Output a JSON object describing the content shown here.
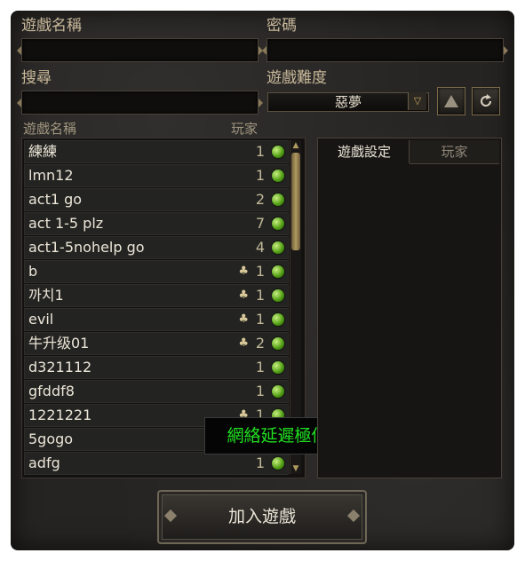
{
  "form": {
    "game_name_label": "遊戲名稱",
    "game_name_value": "",
    "password_label": "密碼",
    "password_value": "",
    "search_label": "搜尋",
    "search_value": "",
    "difficulty_label": "遊戲難度",
    "difficulty_value": "惡夢",
    "difficulty_arrow": "▽"
  },
  "icons": {
    "filter": "delta-icon",
    "refresh": "refresh-icon"
  },
  "list": {
    "header_name": "遊戲名稱",
    "header_players": "玩家",
    "rows": [
      {
        "name": "練練",
        "count": "1",
        "mark": "",
        "status": "ok"
      },
      {
        "name": "lmn12",
        "count": "1",
        "mark": "",
        "status": "ok"
      },
      {
        "name": "act1 go",
        "count": "2",
        "mark": "",
        "status": "ok"
      },
      {
        "name": "act 1-5 plz",
        "count": "7",
        "mark": "",
        "status": "ok"
      },
      {
        "name": "act1-5nohelp go",
        "count": "4",
        "mark": "",
        "status": "ok"
      },
      {
        "name": "b",
        "count": "1",
        "mark": "♣",
        "status": "ok"
      },
      {
        "name": "까치1",
        "count": "1",
        "mark": "♣",
        "status": "ok"
      },
      {
        "name": "evil",
        "count": "1",
        "mark": "♣",
        "status": "ok"
      },
      {
        "name": "牛升级01",
        "count": "2",
        "mark": "♣",
        "status": "ok"
      },
      {
        "name": "d321112",
        "count": "1",
        "mark": "",
        "status": "ok"
      },
      {
        "name": "gfddf8",
        "count": "1",
        "mark": "",
        "status": "ok"
      },
      {
        "name": "1221221",
        "count": "1",
        "mark": "♣",
        "status": "ok"
      },
      {
        "name": "5gogo",
        "count": "",
        "mark": "",
        "status": "ok"
      },
      {
        "name": "adfg",
        "count": "1",
        "mark": "",
        "status": "ok"
      }
    ]
  },
  "tooltip": "網絡延遲極低",
  "tabs": {
    "settings": "遊戲設定",
    "players": "玩家"
  },
  "join_button": "加入遊戲",
  "colors": {
    "status_ok": "#4c9a10",
    "tooltip_text": "#20e020",
    "label": "#c8b89a"
  }
}
